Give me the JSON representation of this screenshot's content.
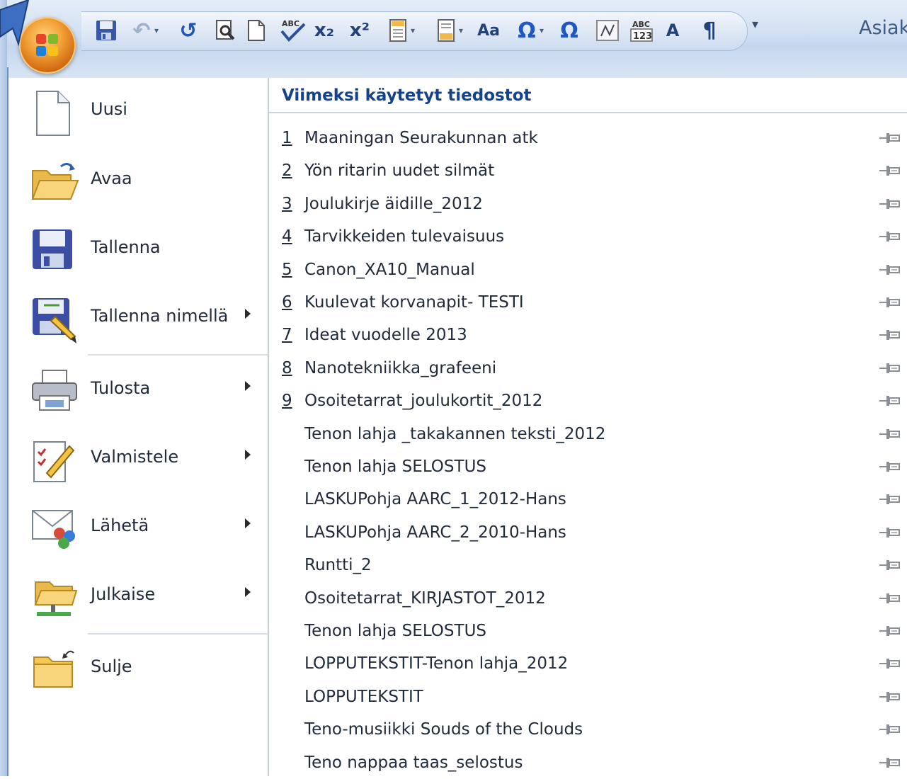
{
  "window": {
    "document_title": "Asiaki"
  },
  "quick_access_toolbar": {
    "buttons": [
      {
        "icon": "save-icon"
      },
      {
        "icon": "undo-icon"
      },
      {
        "icon": "redo-icon"
      },
      {
        "icon": "print-preview-icon"
      },
      {
        "icon": "new-document-icon"
      },
      {
        "icon": "spelling-check-icon"
      },
      {
        "icon": "subscript-icon",
        "text": "x₂"
      },
      {
        "icon": "superscript-icon",
        "text": "x²"
      },
      {
        "icon": "header-icon"
      },
      {
        "icon": "footer-icon"
      },
      {
        "icon": "change-case-icon"
      },
      {
        "icon": "insert-symbol-icon",
        "text": "Ω"
      },
      {
        "icon": "symbol-icon",
        "text": "Ω"
      },
      {
        "icon": "equation-icon"
      },
      {
        "icon": "word-count-icon"
      },
      {
        "icon": "grow-font-icon"
      },
      {
        "icon": "paragraph-mark-icon",
        "text": "¶"
      }
    ],
    "customize_icon": "customize-toolbar-icon"
  },
  "office_button": {
    "icon": "office-logo-icon"
  },
  "office_menu": {
    "commands": [
      {
        "label": "Uusi",
        "icon": "new-document-icon",
        "submenu": false
      },
      {
        "label": "Avaa",
        "icon": "open-folder-icon",
        "submenu": false
      },
      {
        "label": "Tallenna",
        "icon": "save-icon",
        "submenu": false
      },
      {
        "label": "Tallenna nimellä",
        "icon": "save-as-icon",
        "submenu": true
      },
      {
        "label": "Tulosta",
        "icon": "printer-icon",
        "submenu": true
      },
      {
        "label": "Valmistele",
        "icon": "prepare-icon",
        "submenu": true
      },
      {
        "label": "Lähetä",
        "icon": "send-icon",
        "submenu": true
      },
      {
        "label": "Julkaise",
        "icon": "publish-icon",
        "submenu": true
      },
      {
        "label": "Sulje",
        "icon": "close-folder-icon",
        "submenu": false
      }
    ],
    "recent_title": "Viimeksi käytetyt tiedostot",
    "recent_files": [
      {
        "num": "1",
        "name": "Maaningan Seurakunnan atk"
      },
      {
        "num": "2",
        "name": "Yön ritarin uudet silmät"
      },
      {
        "num": "3",
        "name": "Joulukirje äidille_2012"
      },
      {
        "num": "4",
        "name": "Tarvikkeiden tulevaisuus"
      },
      {
        "num": "5",
        "name": "Canon_XA10_Manual"
      },
      {
        "num": "6",
        "name": "Kuulevat korvanapit- TESTI"
      },
      {
        "num": "7",
        "name": "Ideat vuodelle 2013"
      },
      {
        "num": "8",
        "name": "Nanotekniikka_grafeeni"
      },
      {
        "num": "9",
        "name": "Osoitetarrat_joulukortit_2012"
      },
      {
        "num": "",
        "name": "Tenon lahja _takakannen teksti_2012"
      },
      {
        "num": "",
        "name": "Tenon lahja SELOSTUS"
      },
      {
        "num": "",
        "name": "LASKUPohja AARC_1_2012-Hans"
      },
      {
        "num": "",
        "name": "LASKUPohja AARC_2_2010-Hans"
      },
      {
        "num": "",
        "name": "Runtti_2"
      },
      {
        "num": "",
        "name": "Osoitetarrat_KIRJASTOT_2012"
      },
      {
        "num": "",
        "name": "Tenon lahja SELOSTUS"
      },
      {
        "num": "",
        "name": "LOPPUTEKSTIT-Tenon lahja_2012"
      },
      {
        "num": "",
        "name": "LOPPUTEKSTIT"
      },
      {
        "num": "",
        "name": "Teno-musiikki Souds of the Clouds"
      },
      {
        "num": "",
        "name": "Teno nappaa taas_selostus"
      }
    ]
  },
  "colors": {
    "accent_blue": "#15428b",
    "orb_orange": "#f3a33a"
  }
}
